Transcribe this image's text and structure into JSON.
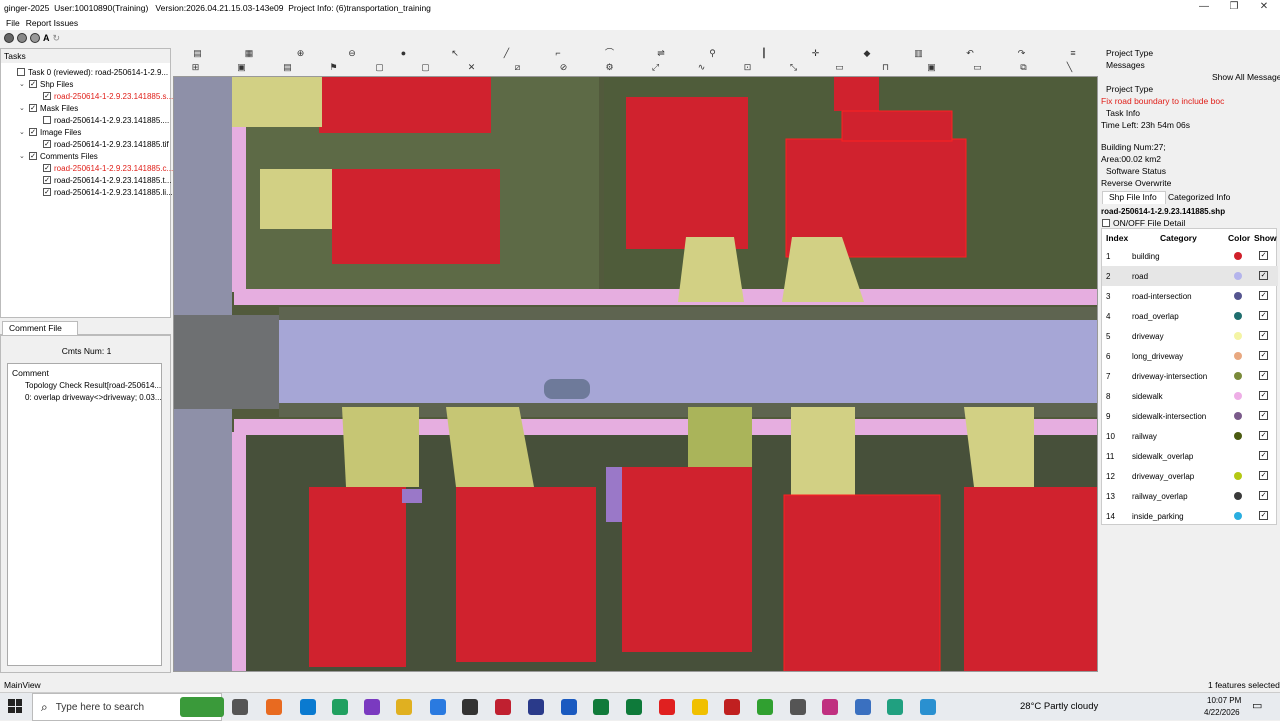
{
  "window": {
    "app_name": "ginger-2025",
    "user": "User:10010890(Training)",
    "version": "Version:2026.04.21.15.03-143e09",
    "project_info": "Project Info: (6)transportation_training"
  },
  "menu": [
    "File",
    "Report Issues"
  ],
  "tasks": {
    "header": "Tasks",
    "items": [
      {
        "label": "Task 0 (reviewed): road-250614-1-2.9...",
        "level": 0,
        "checked": false,
        "red": false
      },
      {
        "label": "Shp Files",
        "level": 1,
        "checked": true,
        "red": false
      },
      {
        "label": "road-250614-1-2.9.23.141885.s...",
        "level": 2,
        "checked": true,
        "red": true
      },
      {
        "label": "Mask Files",
        "level": 1,
        "checked": true,
        "red": false
      },
      {
        "label": "road-250614-1-2.9.23.141885....",
        "level": 2,
        "checked": false,
        "red": false
      },
      {
        "label": "Image Files",
        "level": 1,
        "checked": true,
        "red": false
      },
      {
        "label": "road-250614-1-2.9.23.141885.tif",
        "level": 2,
        "checked": true,
        "red": false
      },
      {
        "label": "Comments Files",
        "level": 1,
        "checked": true,
        "red": false
      },
      {
        "label": "road-250614-1-2.9.23.141885.c...",
        "level": 2,
        "checked": true,
        "red": true
      },
      {
        "label": "road-250614-1-2.9.23.141885.t...",
        "level": 2,
        "checked": true,
        "red": false
      },
      {
        "label": "road-250614-1-2.9.23.141885.li...",
        "level": 2,
        "checked": true,
        "red": false
      }
    ]
  },
  "comment_panel": {
    "tab": "Comment File Info",
    "cmts_num": "Cmts Num:  1",
    "column": "Comment",
    "lines": [
      "Topology Check Result[road-250614...",
      "0: overlap driveway<>driveway; 0.03..."
    ]
  },
  "right_panel": {
    "project_type_label": "Project Type",
    "messages_label": "Messages",
    "show_all": "Show All Messages",
    "project_type2": "Project Type",
    "message": "Fix road boundary to include boc",
    "task_info": "Task Info",
    "time_left": "Time Left: 23h 54m 06s",
    "building_num": "Building Num:27;",
    "area": "Area:00.02 km2",
    "software_status": "Software Status",
    "reverse_overwrite": "Reverse Overwrite",
    "tab_shp": "Shp File Info",
    "tab_cat": "Categorized Info",
    "shp_file": "road-250614-1-2.9.23.141885.shp",
    "on_off": "ON/OFF File Detail",
    "columns": [
      "Index",
      "Category",
      "Color",
      "Show"
    ],
    "categories": [
      {
        "index": "1",
        "name": "building",
        "color": "#d0202a"
      },
      {
        "index": "2",
        "name": "road",
        "color": "#b4b4ec"
      },
      {
        "index": "3",
        "name": "road-intersection",
        "color": "#55558f"
      },
      {
        "index": "4",
        "name": "road_overlap",
        "color": "#1f6e6e"
      },
      {
        "index": "5",
        "name": "driveway",
        "color": "#f4f4a4"
      },
      {
        "index": "6",
        "name": "long_driveway",
        "color": "#e8a880"
      },
      {
        "index": "7",
        "name": "driveway-intersection",
        "color": "#7a8a3a"
      },
      {
        "index": "8",
        "name": "sidewalk",
        "color": "#eeaee6"
      },
      {
        "index": "9",
        "name": "sidewalk-intersection",
        "color": "#7a5a8a"
      },
      {
        "index": "10",
        "name": "railway",
        "color": "#4a5a10"
      },
      {
        "index": "11",
        "name": "sidewalk_overlap",
        "color": "#ffffff"
      },
      {
        "index": "12",
        "name": "driveway_overlap",
        "color": "#b4c814"
      },
      {
        "index": "13",
        "name": "railway_overlap",
        "color": "#3a3a3a"
      },
      {
        "index": "14",
        "name": "inside_parking",
        "color": "#2aaee0"
      }
    ]
  },
  "status": {
    "left": "MainView",
    "right": "1 features selected"
  },
  "taskbar": {
    "search_placeholder": "Type here to search",
    "weather": "28°C  Partly cloudy",
    "time": "10:07 PM",
    "date": "4/22/2026"
  }
}
